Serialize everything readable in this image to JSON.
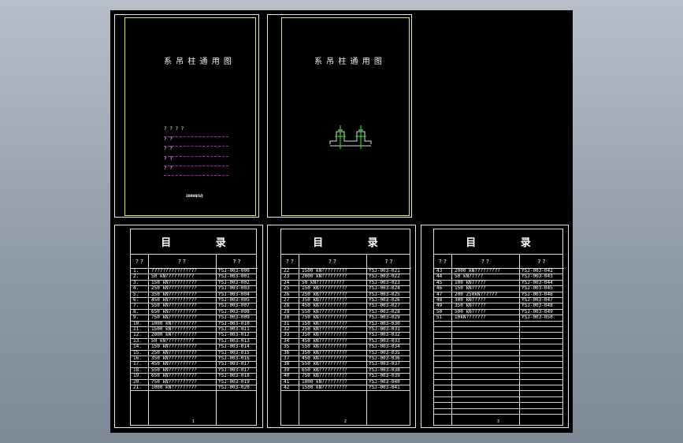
{
  "cover1": {
    "title": "系 吊 柱 通 用 图",
    "q_lines": [
      "? ? ? ?",
      "?          ?",
      "?          ?",
      "?          ?",
      "?          ?"
    ],
    "stamp": "2009年5月"
  },
  "cover2": {
    "title": "系 吊 柱 通 用 图"
  },
  "tables": [
    {
      "heading": "目  录",
      "col1": "? ?",
      "col2": "?          ?",
      "col3": "?  ?",
      "page": "1",
      "rows": [
        [
          "1.",
          "????????????????",
          "YSJ-003-000"
        ],
        [
          "2.",
          "50  kN??????????",
          "YSJ-003-001"
        ],
        [
          "3.",
          "150 kN??????????",
          "YSJ-003-002"
        ],
        [
          "4.",
          "250 kN??????????",
          "YSJ-003-003"
        ],
        [
          "5.",
          "350 kN??????????",
          "YSJ-003-004"
        ],
        [
          "6.",
          "450 kN??????????",
          "YSJ-003-005"
        ],
        [
          "7.",
          "550 kN??????????",
          "YSJ-003-007"
        ],
        [
          "8.",
          "650 kN??????????",
          "YSJ-003-008"
        ],
        [
          "9.",
          "750 kN??????????",
          "YSJ-003-009"
        ],
        [
          "10.",
          "1000 kN?????????",
          "YSJ-003-010"
        ],
        [
          "11.",
          "1500 kN?????????",
          "YSJ-003-011"
        ],
        [
          "12.",
          "2000 kN?????????",
          "YSJ-003-012"
        ],
        [
          "13.",
          "50  kN??????????",
          "YSJ-003-013"
        ],
        [
          "14.",
          "150 kN??????????",
          "YSJ-003-014"
        ],
        [
          "15.",
          "250 kN??????????",
          "YSJ-003-015"
        ],
        [
          "16.",
          "350 kN??????????",
          "YSJ-003-016"
        ],
        [
          "17.",
          "450 kN??????????",
          "YSJ-003-017"
        ],
        [
          "18.",
          "550 kN??????????",
          "YSJ-003-017"
        ],
        [
          "19.",
          "650 kN??????????",
          "YSJ-003-018"
        ],
        [
          "20.",
          "750 kN??????????",
          "YSJ-003-019"
        ],
        [
          "21.",
          "1000 kN?????????",
          "YSJ-003-020"
        ]
      ]
    },
    {
      "heading": "目  录",
      "col1": "? ?",
      "col2": "?          ?",
      "col3": "?  ?",
      "page": "2",
      "rows": [
        [
          "22",
          "1500 kN?????????",
          "YSJ-003-021"
        ],
        [
          "23",
          "2000 kN?????????",
          "YSJ-003-022"
        ],
        [
          "24",
          "50  kN??????????",
          "YSJ-003-023"
        ],
        [
          "25",
          "150 kN??????????",
          "YSJ-003-024"
        ],
        [
          "26",
          "250 kN??????????",
          "YSJ-003-025"
        ],
        [
          "27",
          "350 kN??????????",
          "YSJ-003-026"
        ],
        [
          "28",
          "450 kN??????????",
          "YSJ-003-027"
        ],
        [
          "29",
          "550 kN??????????",
          "YSJ-003-028"
        ],
        [
          "30",
          "750 kN??????????",
          "YSJ-003-029"
        ],
        [
          "31",
          "150 kN??????????",
          "YSJ-003-030"
        ],
        [
          "32",
          "250 kN??????????",
          "YSJ-003-031"
        ],
        [
          "33",
          "350 kN??????????",
          "YSJ-003-032"
        ],
        [
          "34",
          "450 kN??????????",
          "YSJ-003-033"
        ],
        [
          "35",
          "550 kN??????????",
          "YSJ-003-034"
        ],
        [
          "36",
          "350 kN??????????",
          "YSJ-003-035"
        ],
        [
          "37",
          "450 kN??????????",
          "YSJ-003-036"
        ],
        [
          "38",
          "550 kN??????????",
          "YSJ-003-037"
        ],
        [
          "39",
          "650 kN??????????",
          "YSJ-003-038"
        ],
        [
          "40",
          "750 kN??????????",
          "YSJ-003-039"
        ],
        [
          "41",
          "1000 kN?????????",
          "YSJ-003-040"
        ],
        [
          "42",
          "1500 kN?????????",
          "YSJ-003-041"
        ]
      ]
    },
    {
      "heading": "目  录",
      "col1": "? ?",
      "col2": "?          ?",
      "col3": "?  ?",
      "page": "3",
      "rows": [
        [
          "43",
          "2000 kN?????????",
          "YSJ-003-042"
        ],
        [
          "44",
          "50 kN?????",
          "YSJ-003-043"
        ],
        [
          "45",
          "100 kN?????",
          "YSJ-003-044"
        ],
        [
          "46",
          "150 kN?????",
          "YSJ-003-045"
        ],
        [
          "47",
          "200 250kN??????",
          "YSJ-003-046"
        ],
        [
          "48",
          "300 kN?????",
          "YSJ-003-047"
        ],
        [
          "49",
          "350 kN?????",
          "YSJ-003-048"
        ],
        [
          "50",
          "500 kN?????",
          "YSJ-003-049"
        ],
        [
          "51",
          "10kN???????",
          "YSJ-003-050"
        ],
        [
          "",
          "",
          ""
        ],
        [
          "",
          "",
          ""
        ],
        [
          "",
          "",
          ""
        ],
        [
          "",
          "",
          ""
        ],
        [
          "",
          "",
          ""
        ],
        [
          "",
          "",
          ""
        ],
        [
          "",
          "",
          ""
        ],
        [
          "",
          "",
          ""
        ],
        [
          "",
          "",
          ""
        ],
        [
          "",
          "",
          ""
        ],
        [
          "",
          "",
          ""
        ],
        [
          "",
          "",
          ""
        ],
        [
          "",
          "",
          ""
        ],
        [
          "",
          "",
          ""
        ],
        [
          "",
          "",
          ""
        ],
        [
          "",
          "",
          ""
        ]
      ]
    }
  ]
}
